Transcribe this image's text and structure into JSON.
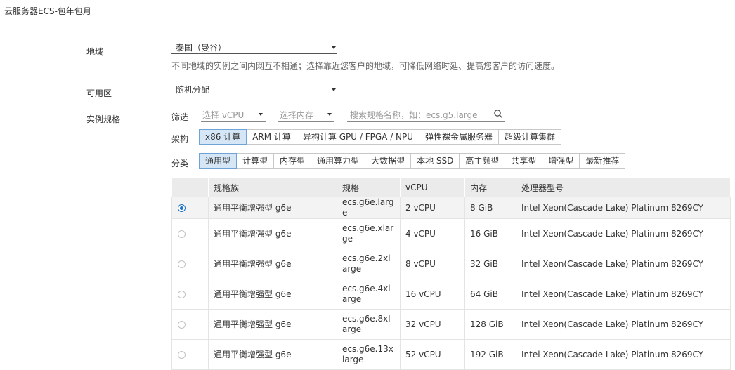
{
  "page": {
    "title": "云服务器ECS-包年包月"
  },
  "region": {
    "label": "地域",
    "value": "泰国（曼谷）",
    "hint": "不同地域的实例之间内网互不相通；选择靠近您客户的地域，可降低网络时延、提高您客户的访问速度。"
  },
  "zone": {
    "label": "可用区",
    "value": "随机分配"
  },
  "instance": {
    "label": "实例规格",
    "filter": {
      "label": "筛选",
      "vcpu_placeholder": "选择 vCPU",
      "memory_placeholder": "选择内存",
      "search_placeholder": "搜索规格名称，如：ecs.g5.large"
    },
    "arch": {
      "label": "架构",
      "options": [
        "x86 计算",
        "ARM 计算",
        "异构计算 GPU / FPGA / NPU",
        "弹性裸金属服务器",
        "超级计算集群"
      ]
    },
    "category": {
      "label": "分类",
      "options": [
        "通用型",
        "计算型",
        "内存型",
        "通用算力型",
        "大数据型",
        "本地 SSD",
        "高主频型",
        "共享型",
        "增强型",
        "最新推荐"
      ]
    },
    "table": {
      "headers": [
        "",
        "规格族",
        "规格",
        "vCPU",
        "内存",
        "处理器型号"
      ],
      "rows": [
        {
          "family": "通用平衡增强型 g6e",
          "spec": "ecs.g6e.large",
          "vcpu": "2 vCPU",
          "memory": "8 GiB",
          "cpu": "Intel Xeon(Cascade Lake) Platinum 8269CY"
        },
        {
          "family": "通用平衡增强型 g6e",
          "spec": "ecs.g6e.xlarge",
          "vcpu": "4 vCPU",
          "memory": "16 GiB",
          "cpu": "Intel Xeon(Cascade Lake) Platinum 8269CY"
        },
        {
          "family": "通用平衡增强型 g6e",
          "spec": "ecs.g6e.2xlarge",
          "vcpu": "8 vCPU",
          "memory": "32 GiB",
          "cpu": "Intel Xeon(Cascade Lake) Platinum 8269CY"
        },
        {
          "family": "通用平衡增强型 g6e",
          "spec": "ecs.g6e.4xlarge",
          "vcpu": "16 vCPU",
          "memory": "64 GiB",
          "cpu": "Intel Xeon(Cascade Lake) Platinum 8269CY"
        },
        {
          "family": "通用平衡增强型 g6e",
          "spec": "ecs.g6e.8xlarge",
          "vcpu": "32 vCPU",
          "memory": "128 GiB",
          "cpu": "Intel Xeon(Cascade Lake) Platinum 8269CY"
        },
        {
          "family": "通用平衡增强型 g6e",
          "spec": "ecs.g6e.13xlarge",
          "vcpu": "52 vCPU",
          "memory": "192 GiB",
          "cpu": "Intel Xeon(Cascade Lake) Platinum 8269CY"
        }
      ]
    }
  },
  "colors": {
    "accent": "#1a73c8",
    "active_bg": "#d5e6f6",
    "header_bg": "#ebebeb"
  }
}
